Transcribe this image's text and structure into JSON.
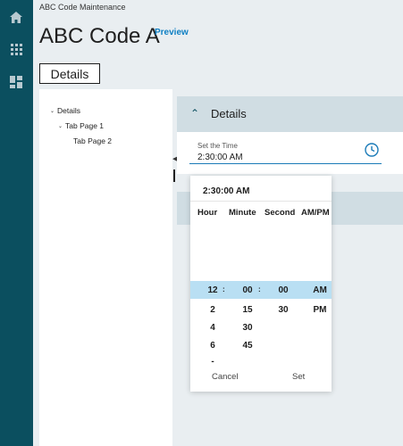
{
  "nav": {
    "icons": [
      "home-icon",
      "apps-grid-icon",
      "dashboard-icon"
    ]
  },
  "breadcrumb": "ABC Code Maintenance",
  "page_title": "ABC Code A",
  "preview_label": "Preview",
  "details_tab_label": "Details",
  "tree": {
    "items": [
      {
        "label": "Details"
      },
      {
        "label": "Tab Page 1"
      },
      {
        "label": "Tab Page 2"
      }
    ]
  },
  "section": {
    "title": "Details"
  },
  "time_field": {
    "label": "Set the Time",
    "value": "2:30:00 AM"
  },
  "picker": {
    "display": "2:30:00 AM",
    "headers": {
      "hour": "Hour",
      "minute": "Minute",
      "second": "Second",
      "ampm": "AM/PM"
    },
    "hours": [
      "12",
      "2",
      "4",
      "6",
      "-"
    ],
    "minutes": [
      "00",
      "15",
      "30",
      "45"
    ],
    "seconds": [
      "00",
      "30"
    ],
    "ampm": [
      "AM",
      "PM"
    ],
    "separator": ":",
    "cancel_label": "Cancel",
    "set_label": "Set"
  },
  "colors": {
    "rail": "#0b4f5f",
    "accent": "#0e7fc3",
    "selected": "#b9dff3",
    "header": "#d0dde3"
  }
}
